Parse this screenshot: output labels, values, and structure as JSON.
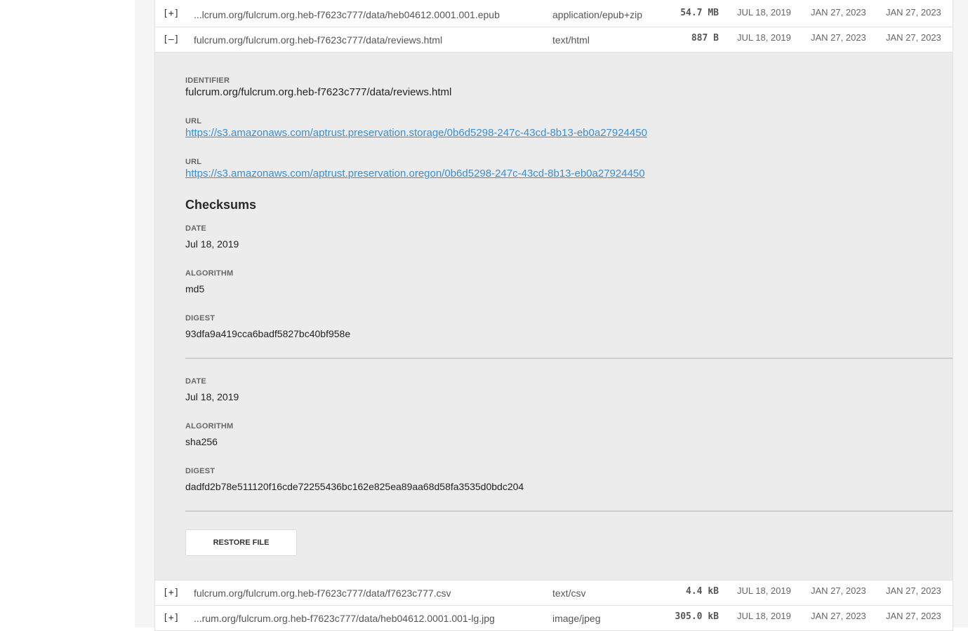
{
  "files": [
    {
      "toggle": "[+]",
      "identifier": "...lcrum.org/fulcrum.org.heb-f7623c777/data/heb04612.0001.001.epub",
      "mime": "application/epub+zip",
      "size": "54.7 MB",
      "created": "JUL 18, 2019",
      "modified": "JAN 27, 2023",
      "updated": "JAN 27, 2023"
    },
    {
      "toggle": "[–]",
      "identifier": "fulcrum.org/fulcrum.org.heb-f7623c777/data/reviews.html",
      "mime": "text/html",
      "size": "887 B",
      "created": "JUL 18, 2019",
      "modified": "JAN 27, 2023",
      "updated": "JAN 27, 2023"
    },
    {
      "toggle": "[+]",
      "identifier": "fulcrum.org/fulcrum.org.heb-f7623c777/data/f7623c777.csv",
      "mime": "text/csv",
      "size": "4.4 kB",
      "created": "JUL 18, 2019",
      "modified": "JAN 27, 2023",
      "updated": "JAN 27, 2023"
    },
    {
      "toggle": "[+]",
      "identifier": "...rum.org/fulcrum.org.heb-f7623c777/data/heb04612.0001.001-lg.jpg",
      "mime": "image/jpeg",
      "size": "305.0 kB",
      "created": "JUL 18, 2019",
      "modified": "JAN 27, 2023",
      "updated": "JAN 27, 2023"
    }
  ],
  "detail": {
    "identifier_label": "IDENTIFIER",
    "identifier_value": "fulcrum.org/fulcrum.org.heb-f7623c777/data/reviews.html",
    "url1_label": "URL",
    "url1_value": "https://s3.amazonaws.com/aptrust.preservation.storage/0b6d5298-247c-43cd-8b13-eb0a27924450",
    "url2_label": "URL",
    "url2_value": "https://s3.amazonaws.com/aptrust.preservation.oregon/0b6d5298-247c-43cd-8b13-eb0a27924450",
    "checksums_title": "Checksums",
    "checksums": [
      {
        "date_label": "DATE",
        "date": "Jul 18, 2019",
        "algorithm_label": "ALGORITHM",
        "algorithm": "md5",
        "digest_label": "DIGEST",
        "digest": "93dfa9a419cca6badf5827bc40bf958e"
      },
      {
        "date_label": "DATE",
        "date": "Jul 18, 2019",
        "algorithm_label": "ALGORITHM",
        "algorithm": "sha256",
        "digest_label": "DIGEST",
        "digest": "dadfd2b78e511120f16cde72255436bc162e825ea89aa68d58fa3535d0bdc204"
      }
    ],
    "restore_label": "RESTORE FILE"
  },
  "colors": {
    "link": "#3b8fd1",
    "detail_background": "#ececec",
    "page_background": "#f5f5f5"
  }
}
